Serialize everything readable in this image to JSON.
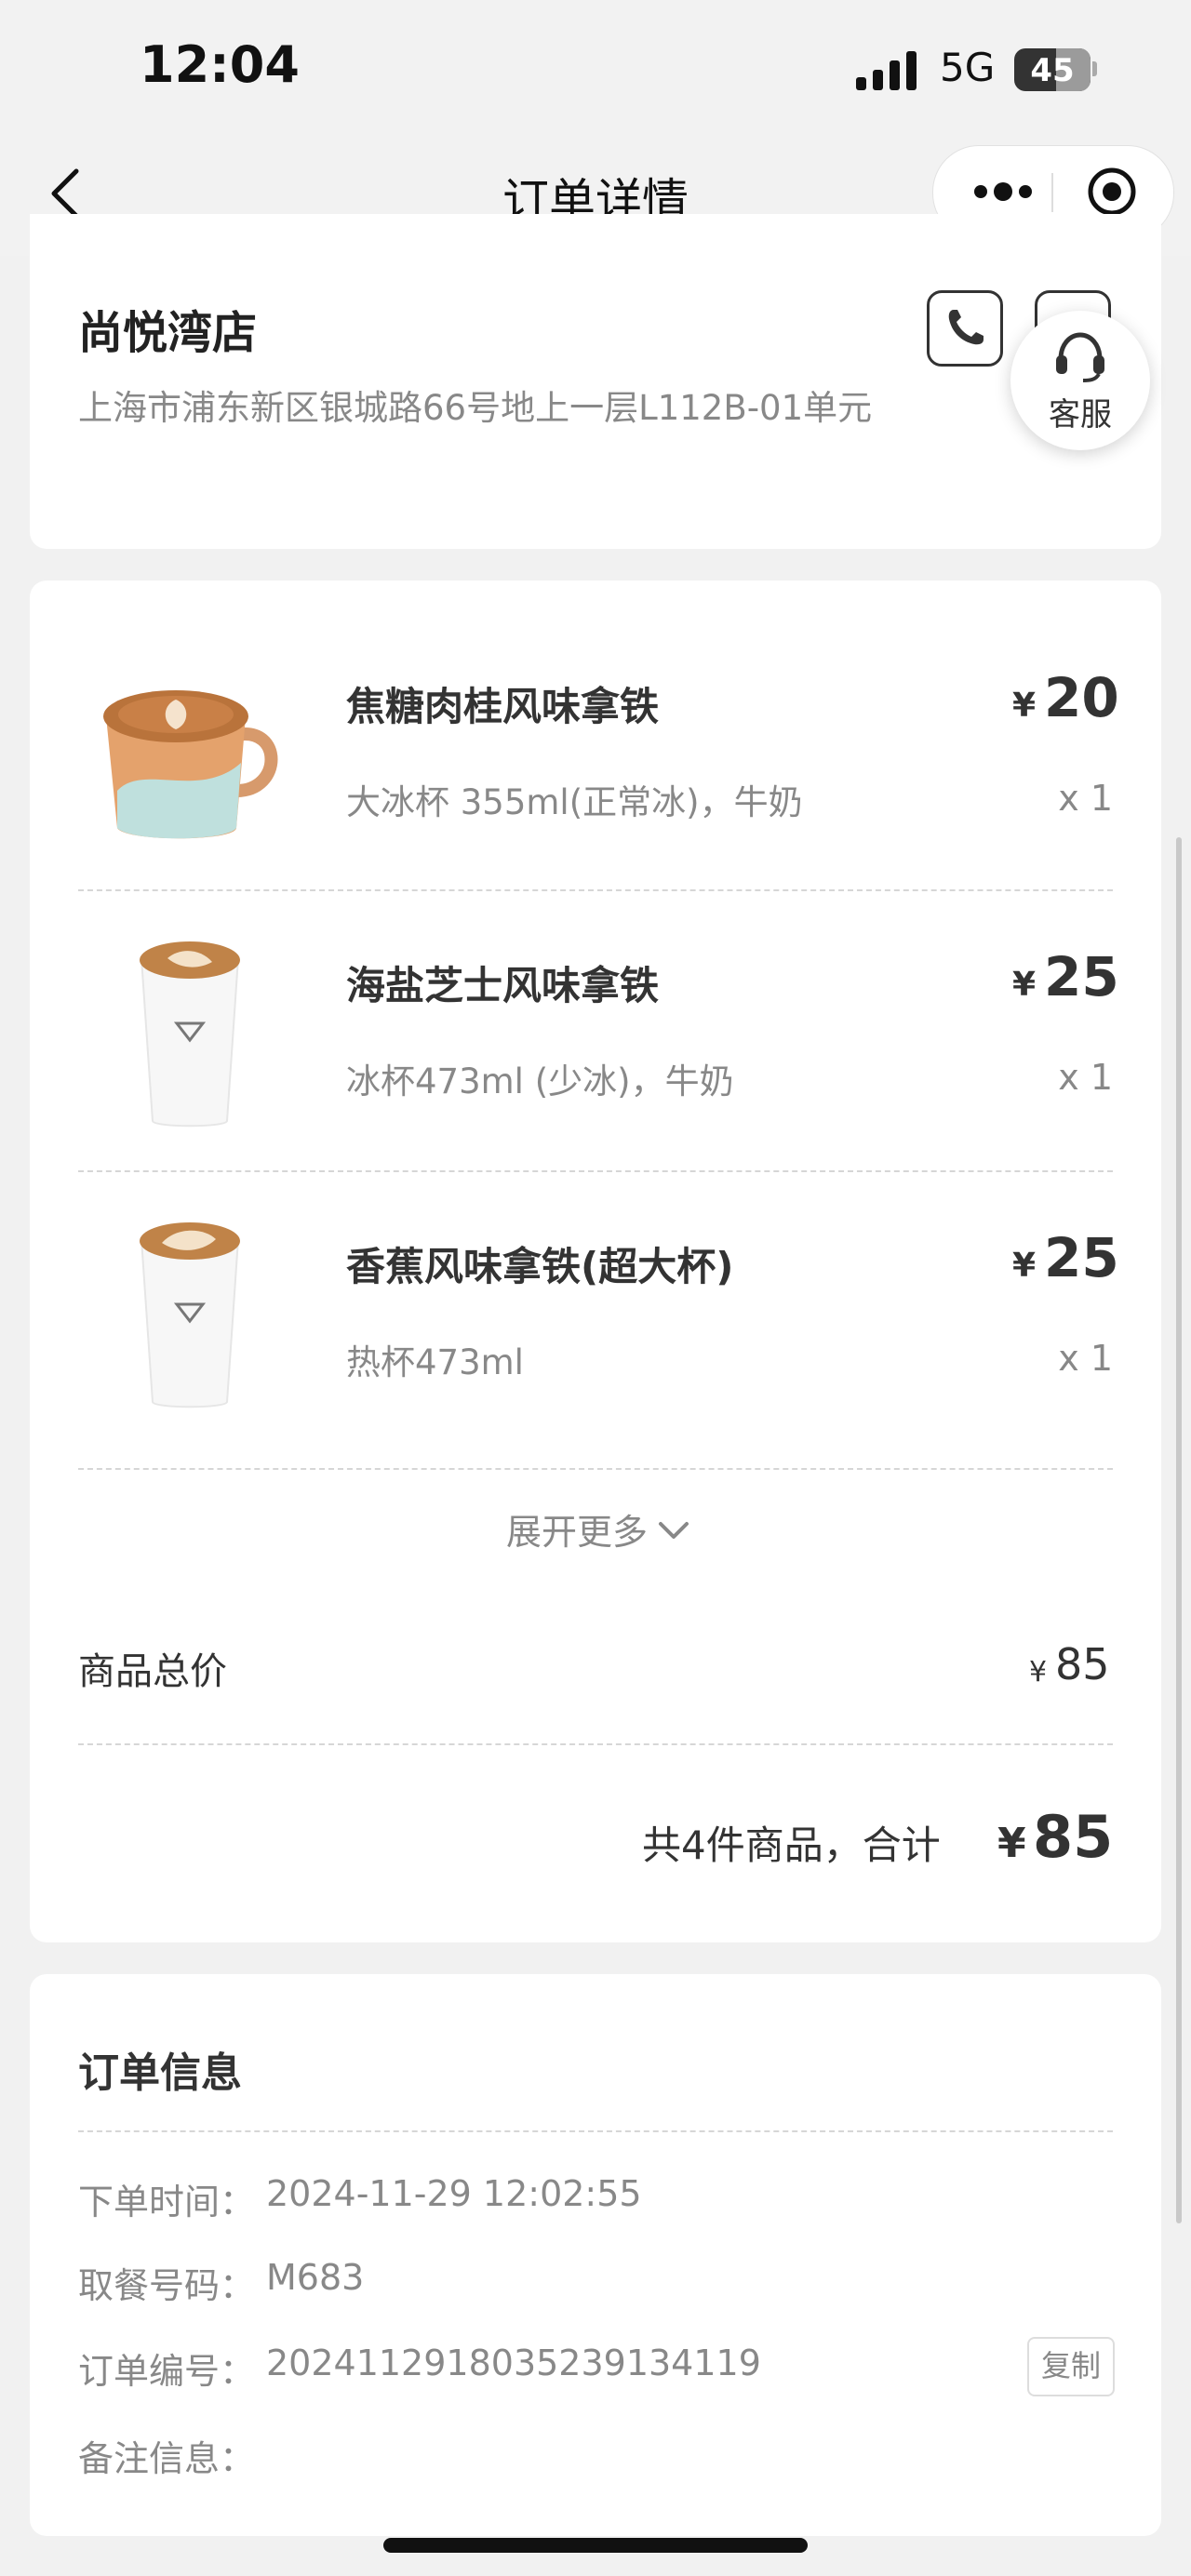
{
  "status_bar": {
    "time": "12:04",
    "network": "5G",
    "battery": "45"
  },
  "nav": {
    "title": "订单详情",
    "back_icon": "chevron-left-icon",
    "more_icon": "more-dots-icon",
    "target_icon": "target-icon"
  },
  "store": {
    "name": "尚悦湾店",
    "address": "上海市浦东新区银城路66号地上一层L112B-01单元",
    "phone_icon": "phone-icon",
    "service_label": "客服",
    "service_icon": "headset-icon"
  },
  "items": [
    {
      "name": "焦糖肉桂风味拿铁",
      "spec": "大冰杯 355ml(正常冰)，牛奶",
      "price_symbol": "¥",
      "price": "20",
      "qty": "x 1",
      "image": "latte-cup-image"
    },
    {
      "name": "海盐芝士风味拿铁",
      "spec": "冰杯473ml (少冰)，牛奶",
      "price_symbol": "¥",
      "price": "25",
      "qty": "x 1",
      "image": "paper-cup-image"
    },
    {
      "name": "香蕉风味拿铁(超大杯)",
      "spec": "热杯473ml",
      "price_symbol": "¥",
      "price": "25",
      "qty": "x 1",
      "image": "paper-cup-image"
    }
  ],
  "expand_more": "展开更多",
  "subtotal": {
    "label": "商品总价",
    "symbol": "¥",
    "value": "85"
  },
  "total": {
    "summary": "共4件商品，合计",
    "symbol": "¥",
    "value": "85"
  },
  "order_info": {
    "title": "订单信息",
    "rows": [
      {
        "label": "下单时间：",
        "value": "2024-11-29 12:02:55"
      },
      {
        "label": "取餐号码：",
        "value": "M683"
      },
      {
        "label": "订单编号：",
        "value": "20241129180352391341​19"
      },
      {
        "label": "备注信息：",
        "value": ""
      }
    ],
    "copy_label": "复制"
  },
  "colors": {
    "background": "#f1f1f1",
    "card": "#ffffff",
    "text": "#333333",
    "muted": "#888888"
  }
}
